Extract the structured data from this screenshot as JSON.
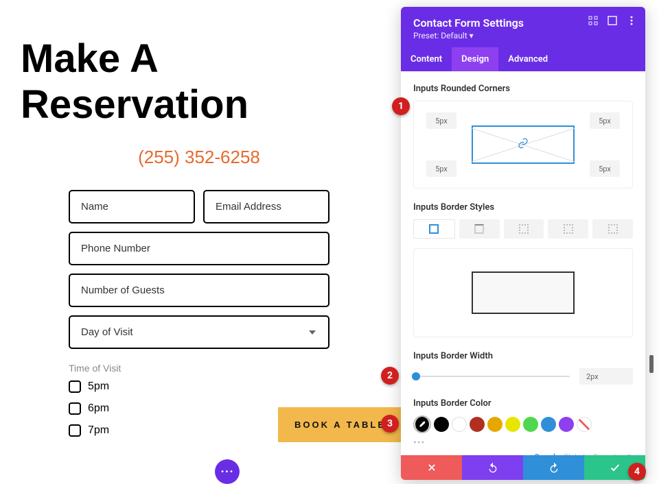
{
  "page": {
    "title": "Make A Reservation",
    "phone": "(255) 352-6258",
    "fields": {
      "name_ph": "Name",
      "email_ph": "Email Address",
      "phone_ph": "Phone Number",
      "guests_ph": "Number of Guests",
      "day_ph": "Day of Visit"
    },
    "time_label": "Time of Visit",
    "times": [
      "5pm",
      "6pm",
      "7pm"
    ],
    "submit": "BOOK A TABLE"
  },
  "panel": {
    "title": "Contact Form Settings",
    "preset": "Preset: Default",
    "tabs": {
      "content": "Content",
      "design": "Design",
      "advanced": "Advanced"
    },
    "corners": {
      "title": "Inputs Rounded Corners",
      "tl": "5px",
      "tr": "5px",
      "bl": "5px",
      "br": "5px"
    },
    "border_styles": "Inputs Border Styles",
    "border_width": {
      "title": "Inputs Border Width",
      "value": "2px"
    },
    "border_color": "Inputs Border Color",
    "color_tabs": {
      "saved": "Saved",
      "global": "Global",
      "recent": "Recent"
    },
    "swatches": [
      "#000000",
      "#ffffff",
      "#b12f1f",
      "#e6a700",
      "#e6e600",
      "#4fd84f",
      "#2f8fd8",
      "#8e3ff0"
    ]
  },
  "callouts": {
    "c1": "1",
    "c2": "2",
    "c3": "3",
    "c4": "4"
  }
}
